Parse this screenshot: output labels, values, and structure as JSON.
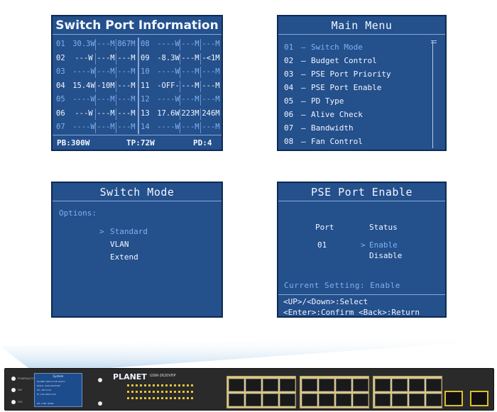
{
  "info_panel": {
    "title": "Switch Port Information",
    "left_rows": [
      {
        "port": "01",
        "power": "30.3W",
        "v1": "---M",
        "v2": "867M",
        "dim": true
      },
      {
        "port": "02",
        "power": "---W",
        "v1": "---M",
        "v2": "---M",
        "dim": false
      },
      {
        "port": "03",
        "power": "----W",
        "v1": "---M",
        "v2": "---M",
        "dim": true
      },
      {
        "port": "04",
        "power": "15.4W",
        "v1": "-10M",
        "v2": "---M",
        "dim": false
      },
      {
        "port": "05",
        "power": "----W",
        "v1": "---M",
        "v2": "---M",
        "dim": true
      },
      {
        "port": "06",
        "power": "---W",
        "v1": "---M",
        "v2": "---M",
        "dim": false
      },
      {
        "port": "07",
        "power": "----W",
        "v1": "---M",
        "v2": "---M",
        "dim": true
      }
    ],
    "right_rows": [
      {
        "port": "08",
        "power": "----W",
        "v1": "---M",
        "v2": "---M",
        "dim": true
      },
      {
        "port": "09",
        "power": "-8.3W",
        "v1": "---M",
        "v2": "-<1M",
        "dim": false
      },
      {
        "port": "10",
        "power": "----W",
        "v1": "---M",
        "v2": "---M",
        "dim": true
      },
      {
        "port": "11",
        "power": "-OFF-",
        "v1": "---M",
        "v2": "---M",
        "dim": false
      },
      {
        "port": "12",
        "power": "----W",
        "v1": "---M",
        "v2": "---M",
        "dim": true
      },
      {
        "port": "13",
        "power": "17.6W",
        "v1": "223M",
        "v2": "246M",
        "dim": false
      },
      {
        "port": "14",
        "power": "----W",
        "v1": "---M",
        "v2": "---M",
        "dim": true
      }
    ],
    "footer": {
      "pb": "PB:300W",
      "tp": "TP:72W",
      "pd": "PD:4"
    }
  },
  "main_menu": {
    "title": "Main Menu",
    "items": [
      {
        "num": "01",
        "label": "Switch Mode",
        "active": true
      },
      {
        "num": "02",
        "label": "Budget Control",
        "active": false
      },
      {
        "num": "03",
        "label": "PSE Port Priority",
        "active": false
      },
      {
        "num": "04",
        "label": "PSE Port Enable",
        "active": false
      },
      {
        "num": "05",
        "label": "PD Type",
        "active": false
      },
      {
        "num": "06",
        "label": "Alive Check",
        "active": false
      },
      {
        "num": "07",
        "label": "Bandwidth",
        "active": false
      },
      {
        "num": "08",
        "label": "Fan Control",
        "active": false
      }
    ],
    "dash": "–"
  },
  "switch_mode": {
    "title": "Switch Mode",
    "options_label": "Options:",
    "cursor": ">",
    "options": [
      {
        "label": "Standard",
        "active": true
      },
      {
        "label": "VLAN",
        "active": false
      },
      {
        "label": "Extend",
        "active": false
      }
    ]
  },
  "pse_port_enable": {
    "title": "PSE Port Enable",
    "col_port": "Port",
    "col_status": "Status",
    "port_value": "01",
    "cursor": ">",
    "status_options": [
      "Enable",
      "Disable"
    ],
    "current_setting": "Current Setting: Enable",
    "help_line1": "<UP>/<Down>:Select",
    "help_line2": "<Enter>:Confirm <Back>:Return"
  },
  "device": {
    "brand": "PLANET",
    "model": "GSW-2620VHP",
    "lcd_title": "System",
    "lcd_lines": [
      "PLANET 26Port PoE Switch",
      "Model: GSW-2620VHP",
      "DC: 48V 6.2A",
      "IP: 192.168.0.100",
      "PD: 4 PB: 300W"
    ],
    "led_labels": [
      "POWER/ACTIVE",
      "PoE",
      "SYS"
    ]
  },
  "colors": {
    "lcd_bg": "#24508c",
    "lcd_text": "#f2f6ff",
    "lcd_highlight": "#7fb2f0"
  }
}
